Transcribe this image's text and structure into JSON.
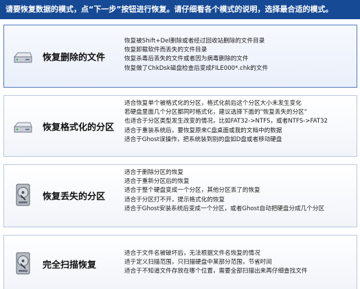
{
  "header": {
    "text": "请要恢复数据的模式，点“下一步”按钮进行恢复。请仔细看各个模式的说明，选择最合适的模式。"
  },
  "modes": [
    {
      "title": "恢复删除的文件",
      "icon": "hard-disk-icon",
      "selected": true,
      "lines": [
        "恢复被Shift+Del删除或者经过回收站删除的文件目录",
        "恢复卸载软件而丢失的文件目录",
        "恢复杀毒后丢失的文件或者因为病毒删除的文件",
        "恢复做了ChkDsk磁盘检查后变成FILE000*.chk的文件"
      ]
    },
    {
      "title": "恢复格式化的分区",
      "icon": "hard-disk-icon",
      "selected": false,
      "lines": [
        "适合恢复单个被格式化的分区，格式化前后这个分区大小未发生变化",
        "若硬盘里面几个分区都同时格式化，建议选择下面的\"恢复丢失的分区\"",
        "也适合于分区类型发生改变的情况，比如FAT32->NTFS，或者NTFS->FAT32",
        "适合于重装系统后，要恢复原来C盘桌面或我的文档中的数据",
        "适合于Ghost误操作，把系统装到别的盘如D盘或者移动硬盘"
      ]
    },
    {
      "title": "恢复丢失的分区",
      "icon": "open-hard-drive-icon",
      "selected": false,
      "lines": [
        "适合于删除分区的恢复",
        "适合于重新分区后的恢复",
        "适合于整个硬盘变成一个分区，其他分区丢了的恢复",
        "适合于分区打不开，提示格式化的恢复",
        "适合于Ghost安装系统后变成一个分区，或者Ghost自动把硬盘分成几个分区"
      ]
    },
    {
      "title": "完全扫描恢复",
      "icon": "open-hard-drive-icon",
      "selected": false,
      "lines": [
        "适合于文件名被破坏后，无法根据文件名恢复的情况",
        "适于定义扫描范围，只扫描硬盘中某部分范围，节省时间",
        "适合于不知道文件存放在哪个位置，需要全部扫描出来再仔细查找文件"
      ]
    }
  ]
}
